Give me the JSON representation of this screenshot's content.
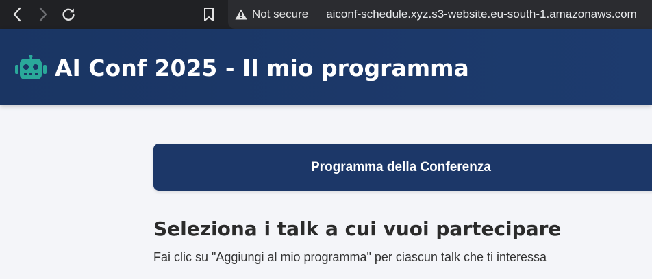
{
  "browser": {
    "security_label": "Not secure",
    "url": "aiconf-schedule.xyz.s3-website.eu-south-1.amazonaws.com"
  },
  "header": {
    "logo_icon": "robot-icon",
    "title": "AI Conf 2025 - Il mio programma",
    "accent_color": "#2aa89a"
  },
  "main": {
    "program_button_label": "Programma della Conferenza",
    "section_title": "Seleziona i talk a cui vuoi partecipare",
    "section_description": "Fai clic su \"Aggiungi al mio programma\" per ciascun talk che ti interessa"
  }
}
